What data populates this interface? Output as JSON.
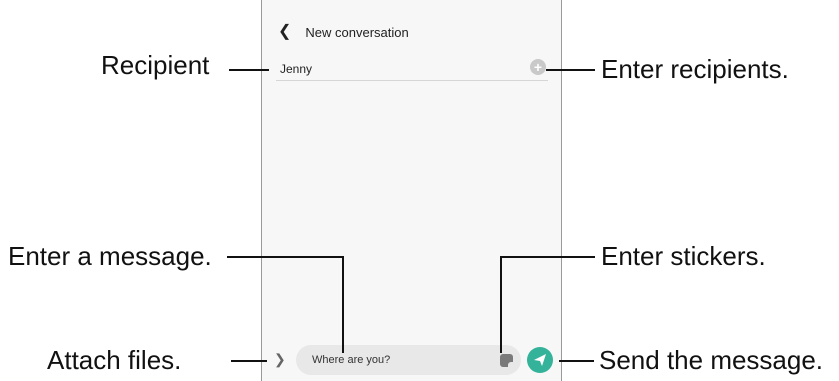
{
  "screen": {
    "title": "New conversation",
    "recipient_value": "Jenny",
    "message_value": "Where are you?"
  },
  "icons": {
    "back": "chevron-left-icon",
    "add_recipient": "plus-circle-icon",
    "expand": "chevron-right-icon",
    "sticker": "sticker-icon",
    "send": "send-arrow-icon"
  },
  "colors": {
    "send_button": "#35b39a",
    "add_button": "#c9c9c9",
    "input_background": "#e8e8e8"
  },
  "callouts": {
    "recipient": "Recipient",
    "enter_recipients": "Enter recipients.",
    "enter_message": "Enter a message.",
    "enter_stickers": "Enter stickers.",
    "attach_files": "Attach files.",
    "send_message": "Send the message."
  }
}
